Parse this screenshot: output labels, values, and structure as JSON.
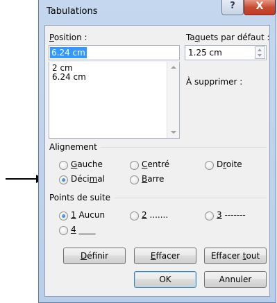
{
  "window": {
    "title": "Tabulations",
    "help_label": "?",
    "close_label": "X"
  },
  "position": {
    "label_pre": "",
    "label_u": "P",
    "label_post": "osition :",
    "value": "6.24 cm",
    "list": [
      "2 cm",
      "6.24 cm"
    ]
  },
  "default_tabs": {
    "label_pre": "Ta",
    "label_u": "q",
    "label_post": "uets par défaut :",
    "value": "1.25 cm"
  },
  "to_clear": {
    "label": "À supprimer :"
  },
  "alignment": {
    "title": "Alignement",
    "options": [
      {
        "pre": "",
        "u": "G",
        "post": "auche",
        "checked": false
      },
      {
        "pre": "",
        "u": "C",
        "post": "entré",
        "checked": false
      },
      {
        "pre": "D",
        "u": "r",
        "post": "oite",
        "checked": false
      },
      {
        "pre": "Déci",
        "u": "m",
        "post": "al",
        "checked": true
      },
      {
        "pre": "",
        "u": "B",
        "post": "arre",
        "checked": false
      }
    ]
  },
  "leader": {
    "title": "Points de suite",
    "options": [
      {
        "pre": "",
        "u": "1",
        "post": " Aucun",
        "checked": true
      },
      {
        "pre": "",
        "u": "2",
        "post": " .......",
        "checked": false
      },
      {
        "pre": "",
        "u": "3",
        "post": " -------",
        "checked": false
      },
      {
        "pre": "",
        "u": "4",
        "post": " ____",
        "checked": false
      }
    ]
  },
  "buttons": {
    "set": {
      "pre": "",
      "u": "D",
      "post": "éfinir"
    },
    "clear": {
      "pre": "",
      "u": "E",
      "post": "ffacer"
    },
    "clear_all": {
      "pre": "Effacer ",
      "u": "t",
      "post": "out"
    },
    "ok": "OK",
    "cancel": "Annuler"
  }
}
